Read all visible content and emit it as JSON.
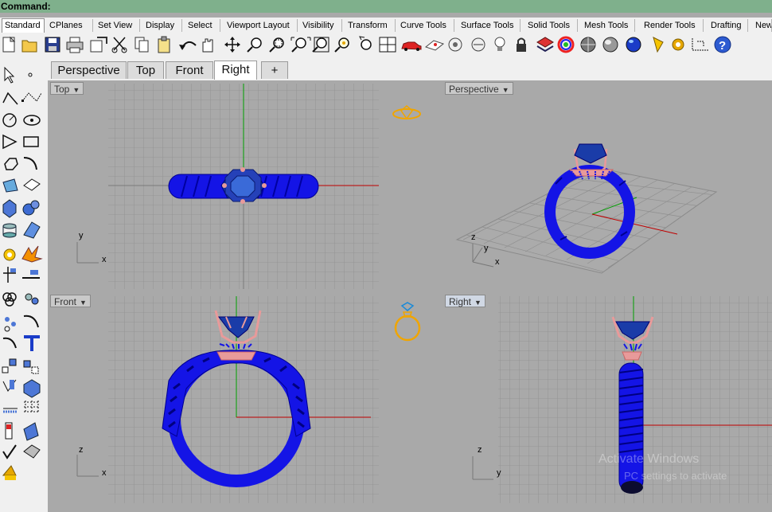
{
  "command": {
    "label": "Command:"
  },
  "tabs": [
    "Standard",
    "CPlanes",
    "Set View",
    "Display",
    "Select",
    "Viewport Layout",
    "Visibility",
    "Transform",
    "Curve Tools",
    "Surface Tools",
    "Solid Tools",
    "Mesh Tools",
    "Render Tools",
    "Drafting",
    "New"
  ],
  "toolbar_icons": [
    "new-icon",
    "open-icon",
    "save-icon",
    "print-icon",
    "export-icon",
    "cut-icon",
    "copy-icon",
    "paste-icon",
    "undo-icon",
    "pan-icon",
    "rotate-icon",
    "zoom-icon",
    "zoom-window-icon",
    "zoom-extents-icon",
    "zoom-selected-icon",
    "zoom-target-icon",
    "undo-view-icon",
    "four-viewports-icon",
    "car-icon",
    "grid-icon",
    "camera-icon",
    "bulb-icon",
    "lock-icon",
    "layer-icon",
    "color-wheel-icon",
    "sphere-icon",
    "sphere-shaded-icon",
    "render-icon",
    "light-icon",
    "settings-icon",
    "snap-icon",
    "help-icon"
  ],
  "viewport_tabs": {
    "perspective": "Perspective",
    "top": "Top",
    "front": "Front",
    "right": "Right",
    "add": "+"
  },
  "viewports": {
    "top": {
      "title": "Top",
      "axis_a": "y",
      "axis_b": "x"
    },
    "perspective": {
      "title": "Perspective",
      "axis_a": "z",
      "axis_b": "y",
      "axis_c": "x"
    },
    "front": {
      "title": "Front",
      "axis_a": "z",
      "axis_b": "x"
    },
    "right": {
      "title": "Right",
      "axis_a": "z",
      "axis_b": "y"
    }
  },
  "watermark": {
    "line1": "Activate Windows",
    "line2": "PC settings to activate"
  },
  "colors": {
    "ring": "#1414e6",
    "prong": "#e89a9a",
    "grid": "#8f8f8f",
    "axis_red": "#c00000",
    "axis_green": "#00a000",
    "gold": "#f0a500"
  }
}
